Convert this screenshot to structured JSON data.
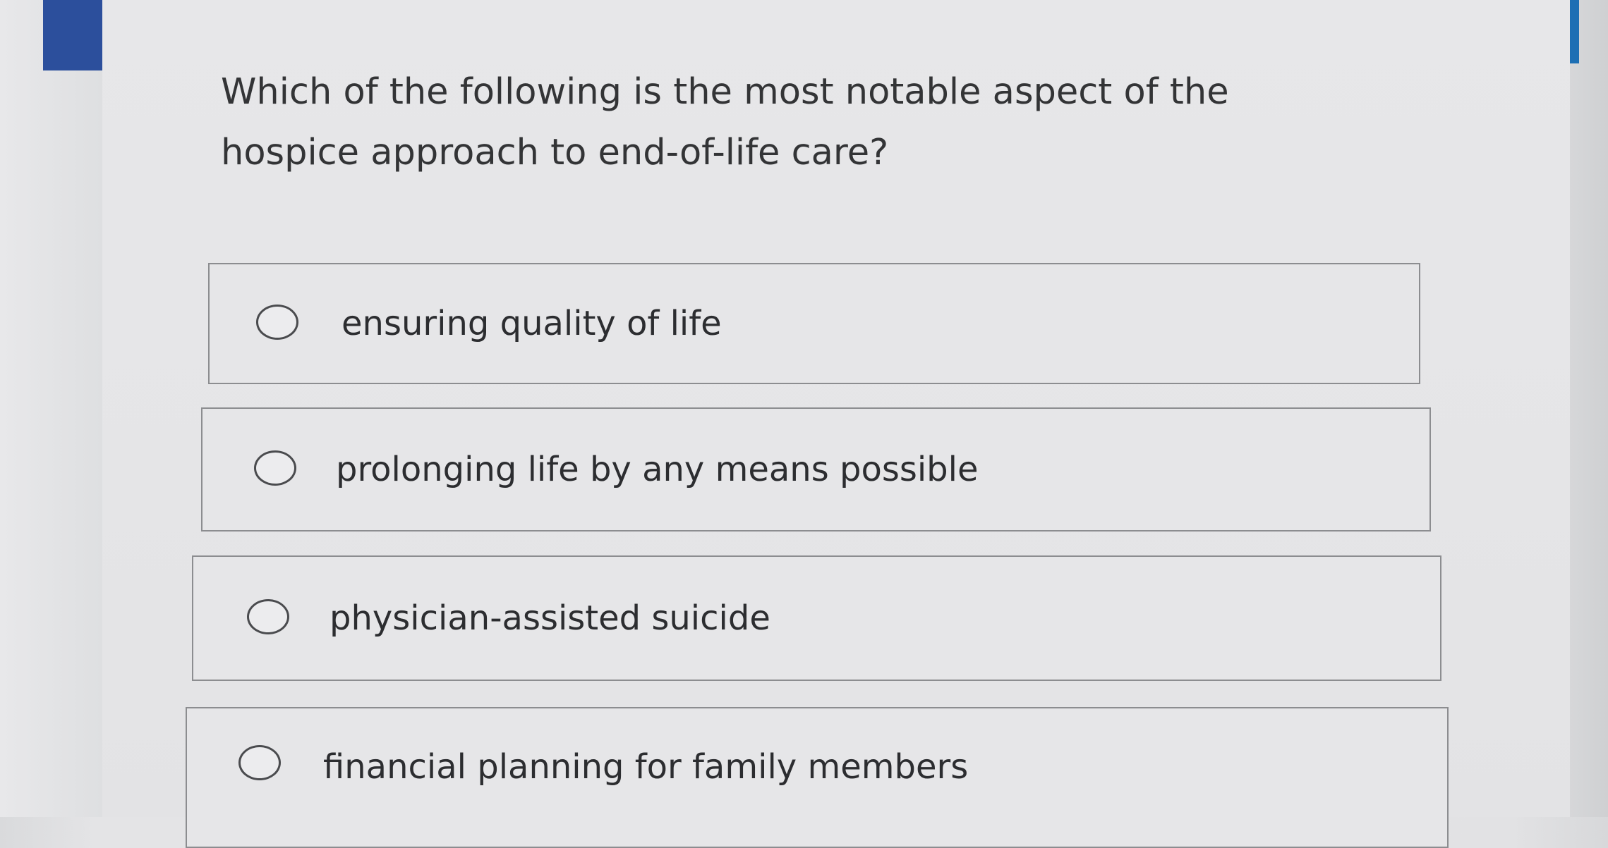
{
  "question": {
    "text": "Which of the following is the most notable aspect of the hospice approach to end-of-life care?"
  },
  "options": [
    {
      "label": "ensuring quality of life",
      "selected": false
    },
    {
      "label": "prolonging life by any means possible",
      "selected": false
    },
    {
      "label": "physician-assisted suicide",
      "selected": false
    },
    {
      "label": "financial planning for family members",
      "selected": false
    }
  ],
  "colors": {
    "accent_left": "#2c4f9c",
    "accent_right": "#1d6fb4",
    "text": "#333436",
    "border": "#8c8d90"
  }
}
